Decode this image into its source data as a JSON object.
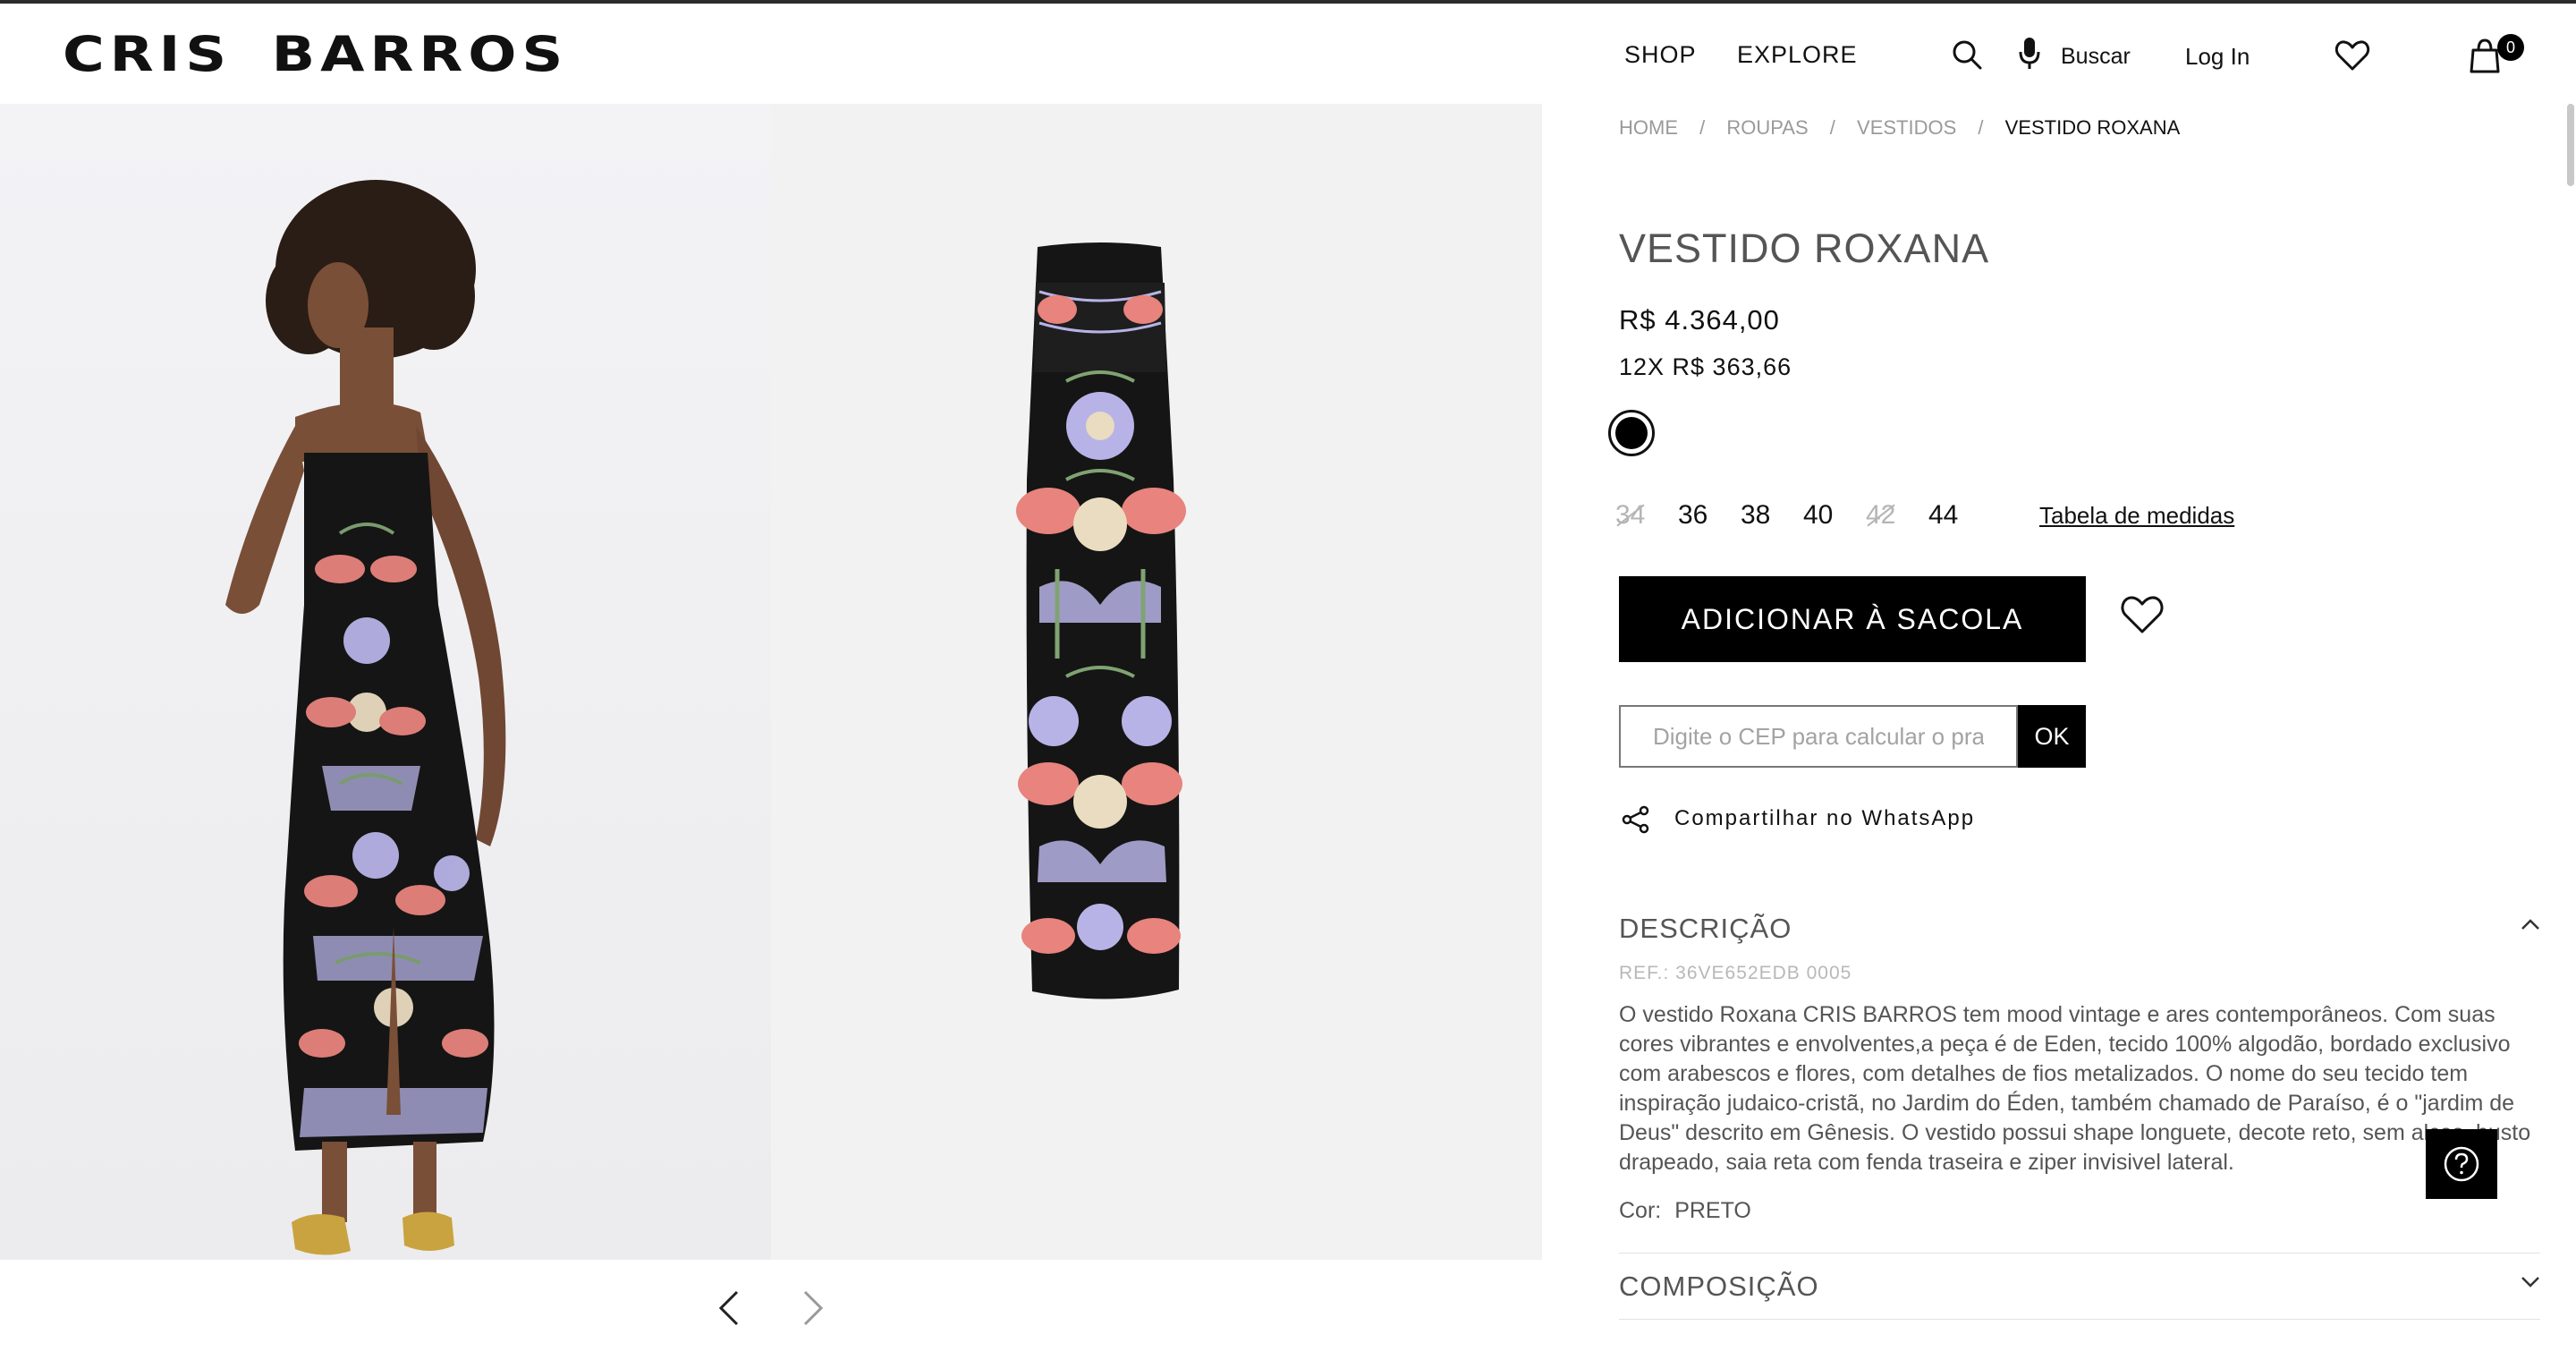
{
  "header": {
    "logo": "CRIS BARROS",
    "nav": {
      "shop": "SHOP",
      "explore": "EXPLORE"
    },
    "search_label": "Buscar",
    "login_label": "Log In",
    "cart_count": "0"
  },
  "breadcrumb": {
    "home": "HOME",
    "roupas": "ROUPAS",
    "vestidos": "VESTIDOS",
    "current": "VESTIDO ROXANA",
    "separator": "/"
  },
  "product": {
    "title": "VESTIDO ROXANA",
    "price": "R$ 4.364,00",
    "installments": "12X R$ 363,66",
    "color_swatch": "#000000",
    "sizes": [
      {
        "label": "34",
        "available": false
      },
      {
        "label": "36",
        "available": true
      },
      {
        "label": "38",
        "available": true
      },
      {
        "label": "40",
        "available": true
      },
      {
        "label": "42",
        "available": false
      },
      {
        "label": "44",
        "available": true
      }
    ],
    "size_table_label": "Tabela de medidas",
    "add_to_bag_label": "ADICIONAR À SACOLA",
    "cep_placeholder": "Digite o CEP para calcular o prazo",
    "cep_value": "",
    "ok_label": "OK",
    "share_label": "Compartilhar no WhatsApp"
  },
  "description": {
    "title": "DESCRIÇÃO",
    "ref": "REF.: 36VE652EDB 0005",
    "text": "O vestido Roxana CRIS BARROS tem mood vintage e ares contemporâneos. Com suas cores vibrantes e envolventes,a peça é de Eden, tecido 100% algodão, bordado exclusivo com arabescos e flores, com detalhes de fios metalizados. O nome do seu tecido tem inspiração judaico-cristã, no Jardim do Éden, também chamado de Paraíso, é o \"jardim de Deus\" descrito em Gênesis. O vestido possui shape longuete, decote reto, sem alças, busto drapeado, saia reta com fenda traseira e ziper invisivel lateral.",
    "color_label": "Cor:",
    "color_value": "PRETO"
  },
  "composition": {
    "title": "COMPOSIÇÃO"
  },
  "icons": {
    "search": "search-icon",
    "mic": "microphone-icon",
    "wishlist": "heart-icon",
    "cart": "bag-icon",
    "share": "share-icon",
    "help": "question-icon",
    "prev": "chevron-left-icon",
    "next": "chevron-right-icon"
  },
  "colors": {
    "accent": "#000000",
    "dress_pink": "#e8837d",
    "dress_lavender": "#b7b3e6",
    "dress_green": "#7fa372",
    "dress_cream": "#e9dcc0",
    "shoe_gold": "#c9a340"
  }
}
